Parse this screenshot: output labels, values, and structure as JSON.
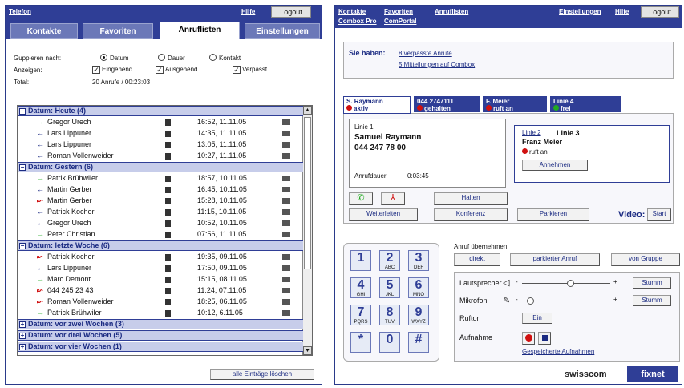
{
  "left": {
    "topbar": {
      "title": "Telefon",
      "help": "Hilfe",
      "logout": "Logout"
    },
    "tabs": [
      "Kontakte",
      "Favoriten",
      "Anruflisten",
      "Einstellungen"
    ],
    "group_label": "Guppieren nach:",
    "group_options": [
      "Datum",
      "Dauer",
      "Kontakt"
    ],
    "show_label": "Anzeigen:",
    "show_options": [
      "Eingehend",
      "Ausgehend",
      "Verpasst"
    ],
    "total_label": "Total:",
    "total_value": "20 Anrufe / 00:23:03",
    "groups": [
      {
        "title": "Datum: Heute (4)",
        "open": true,
        "rows": [
          {
            "arrow": "→",
            "name": "Gregor Urech",
            "time": "16:52, 11.11.05"
          },
          {
            "arrow": "←",
            "name": "Lars Lippuner",
            "time": "14:35, 11.11.05"
          },
          {
            "arrow": "←",
            "name": "Lars Lippuner",
            "time": "13:05, 11.11.05"
          },
          {
            "arrow": "←",
            "name": "Roman Vollenweider",
            "time": "10:27, 11.11.05"
          }
        ]
      },
      {
        "title": "Datum: Gestern (6)",
        "open": true,
        "rows": [
          {
            "arrow": "→",
            "name": "Patrik Brühwiler",
            "time": "18:57, 10.11.05"
          },
          {
            "arrow": "←",
            "name": "Martin Gerber",
            "time": "16:45, 10.11.05"
          },
          {
            "arrow": "↜",
            "name": "Martin Gerber",
            "time": "15:28, 10.11.05"
          },
          {
            "arrow": "←",
            "name": "Patrick Kocher",
            "time": "11:15, 10.11.05"
          },
          {
            "arrow": "←",
            "name": "Gregor Urech",
            "time": "10:52, 10.11.05"
          },
          {
            "arrow": "→",
            "name": "Peter Christian",
            "time": "07:56, 11.11.05"
          }
        ]
      },
      {
        "title": "Datum: letzte Woche (6)",
        "open": true,
        "rows": [
          {
            "arrow": "↜",
            "name": "Patrick Kocher",
            "time": "19:35, 09.11.05"
          },
          {
            "arrow": "←",
            "name": "Lars Lippuner",
            "time": "17:50, 09.11.05"
          },
          {
            "arrow": "→",
            "name": "Marc Demont",
            "time": "15:15, 08.11.05"
          },
          {
            "arrow": "↜",
            "name": "044 245 23 43",
            "time": "11:24, 07.11.05"
          },
          {
            "arrow": "↜",
            "name": "Roman Vollenweider",
            "time": "18:25, 06.11.05"
          },
          {
            "arrow": "→",
            "name": "Patrick Brühwiler",
            "time": "10:12, 6.11.05"
          }
        ]
      },
      {
        "title": "Datum: vor zwei Wochen (3)",
        "open": false,
        "rows": []
      },
      {
        "title": "Datum: vor drei Wochen (5)",
        "open": false,
        "rows": []
      },
      {
        "title": "Datum: vor vier Wochen (1)",
        "open": false,
        "rows": []
      }
    ],
    "delete_all": "alle Einträge löschen"
  },
  "right": {
    "topbar": {
      "links": [
        "Kontakte",
        "Favoriten",
        "Anruflisten"
      ],
      "links2": [
        "Combox Pro",
        "ComPortal"
      ],
      "settings": "Einstellungen",
      "help": "Hilfe",
      "logout": "Logout"
    },
    "info": {
      "prefix": "Sie haben:",
      "missed": "8 verpasste Anrufe",
      "messages": "5 Mitteilungen auf Combox"
    },
    "lines": [
      {
        "name": "S. Raymann",
        "status": "aktiv",
        "color": "#d01010"
      },
      {
        "name": "044 2747111",
        "status": "gehalten",
        "color": "#d01010"
      },
      {
        "name": "F. Meier",
        "status": "ruft an",
        "color": "#d01010"
      },
      {
        "name": "Linie 4",
        "status": "frei",
        "color": "#22aa22"
      }
    ],
    "active_call": {
      "line": "Linie 1",
      "name": "Samuel Raymann",
      "number": "044 247 78 00",
      "duration_label": "Anrufdauer",
      "duration": "0:03:45"
    },
    "incoming": {
      "line2": "Linie 2",
      "line3": "Linie 3",
      "name": "Franz Meier",
      "status": "ruft an",
      "accept": "Annehmen"
    },
    "buttons": {
      "hold": "Halten",
      "forward": "Weiterleiten",
      "conference": "Konferenz",
      "park": "Parkieren",
      "video_label": "Video:",
      "start": "Start"
    },
    "keypad": [
      {
        "n": "1",
        "l": ""
      },
      {
        "n": "2",
        "l": "ABC"
      },
      {
        "n": "3",
        "l": "DEF"
      },
      {
        "n": "4",
        "l": "GHI"
      },
      {
        "n": "5",
        "l": "JKL"
      },
      {
        "n": "6",
        "l": "MNO"
      },
      {
        "n": "7",
        "l": "PQRS"
      },
      {
        "n": "8",
        "l": "TUV"
      },
      {
        "n": "9",
        "l": "WXYZ"
      },
      {
        "n": "*",
        "l": ""
      },
      {
        "n": "0",
        "l": ""
      },
      {
        "n": "#",
        "l": ""
      }
    ],
    "pickup": {
      "label": "Anruf übernehmen:",
      "direct": "direkt",
      "parked": "parkierter Anruf",
      "group": "von Gruppe"
    },
    "audio": {
      "speaker": "Lautsprecher",
      "mic": "Mikrofon",
      "mute": "Stumm",
      "ringtone": "Rufton",
      "ring_on": "Ein",
      "minus": "-",
      "plus": "+",
      "speaker_level": 0.55,
      "mic_level": 0.1
    },
    "record": {
      "label": "Aufnahme",
      "saved": "Gespeicherte Aufnahmen"
    },
    "logo": {
      "swisscom": "swisscom",
      "fixnet": "fixnet"
    }
  }
}
